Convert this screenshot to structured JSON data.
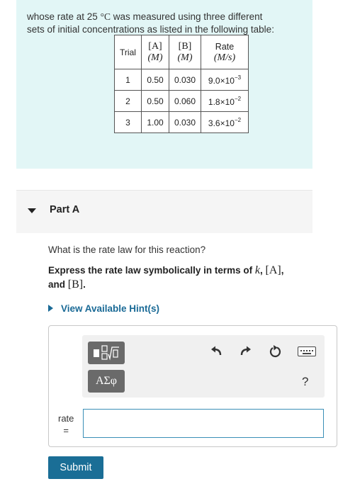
{
  "intro": {
    "line1_before": "whose rate at 25 ",
    "degree_unit": "°C",
    "line1_after": " was measured using three different",
    "line2": "sets of initial concentrations as listed in the following table:"
  },
  "table": {
    "headers": {
      "trial": "Trial",
      "a_top": "[A]",
      "b_top": "[B]",
      "conc_unit": "(M)",
      "rate_top": "Rate",
      "rate_unit": "(M/s)"
    },
    "rows": [
      {
        "trial": "1",
        "a": "0.50",
        "b": "0.030",
        "rate_base": "9.0×10",
        "rate_exp": "−3"
      },
      {
        "trial": "2",
        "a": "0.50",
        "b": "0.060",
        "rate_base": "1.8×10",
        "rate_exp": "−2"
      },
      {
        "trial": "3",
        "a": "1.00",
        "b": "0.030",
        "rate_base": "3.6×10",
        "rate_exp": "−2"
      }
    ]
  },
  "part": {
    "label": "Part A"
  },
  "question": "What is the rate law for this reaction?",
  "express": {
    "prefix": "Express the rate law symbolically in terms of ",
    "k": "k",
    "sep1": ", ",
    "a": "[A]",
    "sep2": ",",
    "and": "and ",
    "b": "[B]",
    "end": "."
  },
  "hint": {
    "label": "View Available Hint(s)"
  },
  "toolbar": {
    "greek_label": "ΑΣφ",
    "help_label": "?"
  },
  "answer": {
    "label_line1": "rate",
    "label_line2": "=",
    "value": ""
  },
  "submit": {
    "label": "Submit"
  },
  "colors": {
    "intro_bg": "#e2f6f6",
    "link": "#1a6a96",
    "submit_bg": "#1a6e96",
    "input_border": "#3a8fb7"
  },
  "icons": [
    "templates-icon",
    "greek-letters-icon",
    "undo-icon",
    "redo-icon",
    "reset-icon",
    "keyboard-icon",
    "help-icon"
  ]
}
